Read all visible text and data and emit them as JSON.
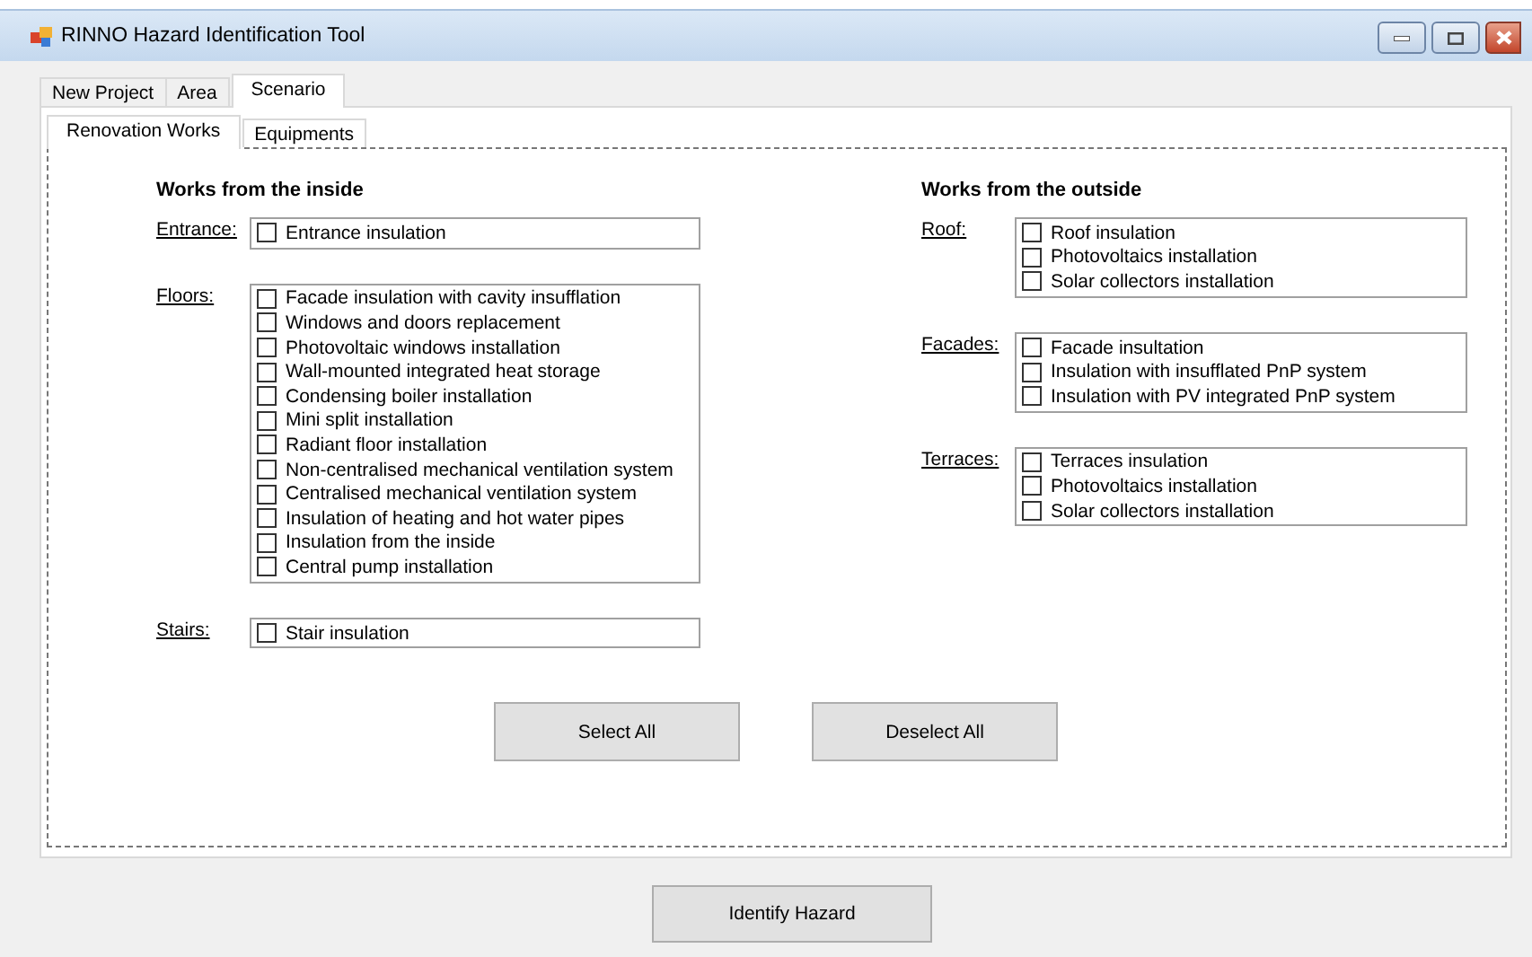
{
  "window": {
    "title": "RINNO Hazard Identification Tool"
  },
  "tabs": [
    {
      "label": "New Project",
      "selected": false
    },
    {
      "label": "Area",
      "selected": false
    },
    {
      "label": "Scenario",
      "selected": true
    }
  ],
  "subtabs": [
    {
      "label": "Renovation Works",
      "selected": true
    },
    {
      "label": "Equipments",
      "selected": false
    }
  ],
  "sections": [
    {
      "heading": "Works from the inside",
      "groups": [
        {
          "label": "Entrance:",
          "items": [
            {
              "label": "Entrance insulation",
              "checked": false
            }
          ]
        },
        {
          "label": "Floors:",
          "items": [
            {
              "label": "Facade insulation with cavity insufflation",
              "checked": false
            },
            {
              "label": "Windows and doors replacement",
              "checked": false
            },
            {
              "label": "Photovoltaic windows installation",
              "checked": false
            },
            {
              "label": "Wall-mounted integrated heat storage",
              "checked": false
            },
            {
              "label": "Condensing boiler installation",
              "checked": false
            },
            {
              "label": "Mini split installation",
              "checked": false
            },
            {
              "label": "Radiant floor installation",
              "checked": false
            },
            {
              "label": "Non-centralised mechanical ventilation system",
              "checked": false
            },
            {
              "label": "Centralised mechanical ventilation system",
              "checked": false
            },
            {
              "label": "Insulation of heating and hot water pipes",
              "checked": false
            },
            {
              "label": "Insulation from the inside",
              "checked": false
            },
            {
              "label": "Central pump installation",
              "checked": false
            }
          ]
        },
        {
          "label": "Stairs:",
          "items": [
            {
              "label": "Stair insulation",
              "checked": false
            }
          ]
        }
      ]
    },
    {
      "heading": "Works from the outside",
      "groups": [
        {
          "label": "Roof:",
          "items": [
            {
              "label": "Roof insulation",
              "checked": false
            },
            {
              "label": "Photovoltaics installation",
              "checked": false
            },
            {
              "label": "Solar collectors installation",
              "checked": false
            }
          ]
        },
        {
          "label": "Facades:",
          "items": [
            {
              "label": "Facade insultation",
              "checked": false
            },
            {
              "label": "Insulation with insufflated PnP system",
              "checked": false
            },
            {
              "label": "Insulation with PV integrated PnP system",
              "checked": false
            }
          ]
        },
        {
          "label": "Terraces:",
          "items": [
            {
              "label": "Terraces insulation",
              "checked": false
            },
            {
              "label": "Photovoltaics installation",
              "checked": false
            },
            {
              "label": "Solar collectors installation",
              "checked": false
            }
          ]
        }
      ]
    }
  ],
  "panel_buttons": [
    "Select All",
    "Deselect All"
  ],
  "main_button": "Identify Hazard"
}
